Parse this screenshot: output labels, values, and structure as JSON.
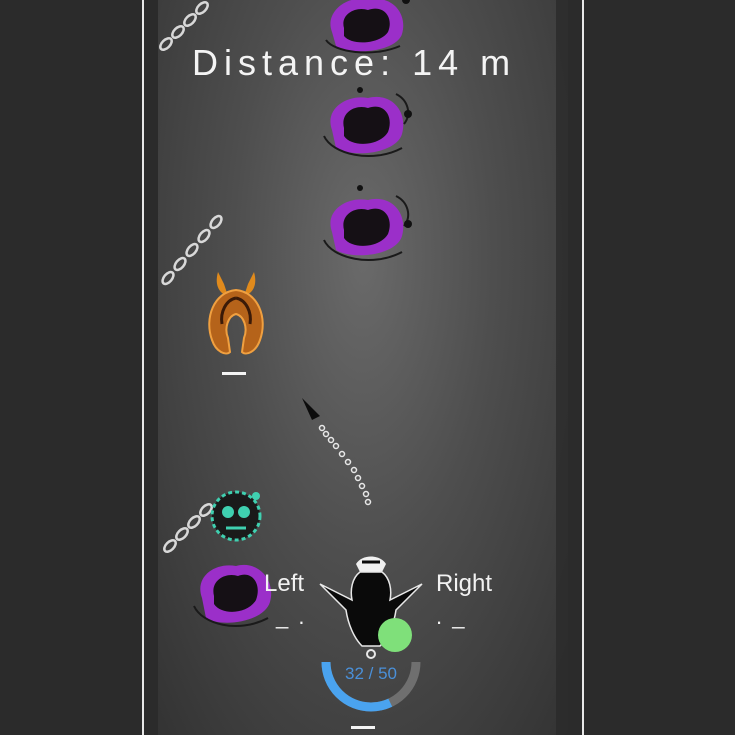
{
  "hud": {
    "distance_label": "Distance:",
    "distance_value": "14",
    "distance_unit": "m",
    "ammo": {
      "current": 32,
      "max": 50,
      "text": "32 / 50"
    }
  },
  "controls": {
    "left_label": "Left",
    "left_hint": "_ .",
    "right_label": "Right",
    "right_hint": ". _"
  },
  "colors": {
    "background": "#2b2b2b",
    "ammo_fill": "#4aa3ef",
    "ammo_empty": "#6f6f6f",
    "enemy_purple": "#9b2fc9",
    "enemy_teal": "#3fd0b0",
    "enemy_orange": "#e08a1c",
    "charge_orb": "#7fe07a"
  },
  "icons": [
    "chain-icon",
    "purple-blob-enemy-icon",
    "orange-horned-enemy-icon",
    "teal-skull-enemy-icon",
    "player-ship-icon",
    "projectile-icon",
    "charge-orb-icon"
  ]
}
